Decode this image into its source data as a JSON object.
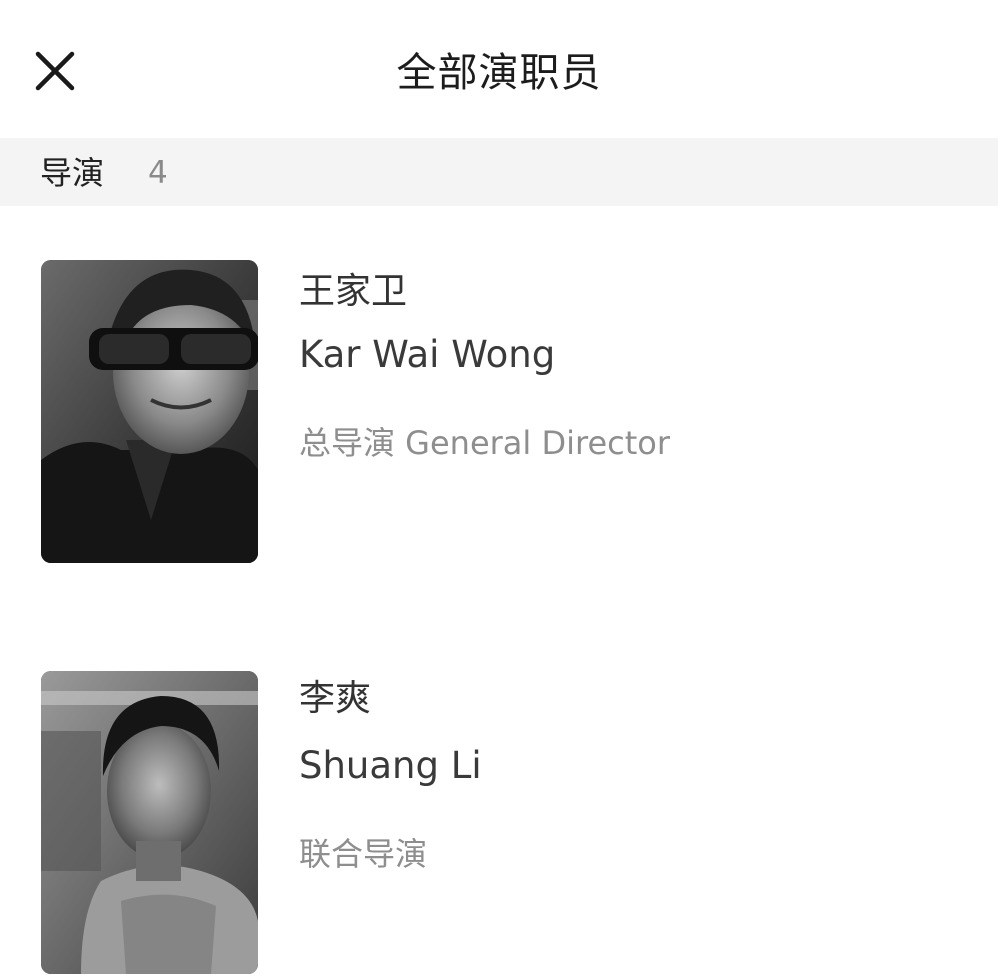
{
  "header": {
    "title": "全部演职员",
    "close_icon": "close-icon"
  },
  "section": {
    "label": "导演",
    "count": "4"
  },
  "people": [
    {
      "cn_name": "王家卫",
      "en_name": "Kar Wai Wong",
      "role": "总导演 General Director",
      "photo_icon": "portrait-photo"
    },
    {
      "cn_name": "李爽",
      "en_name": "Shuang Li",
      "role": "联合导演",
      "photo_icon": "portrait-photo"
    }
  ]
}
